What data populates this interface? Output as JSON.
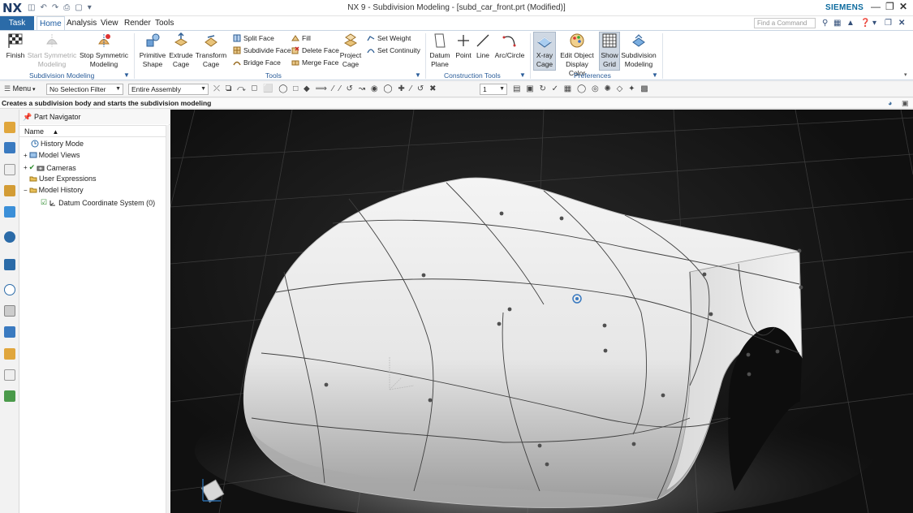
{
  "app": {
    "logo": "NX",
    "window_title": "NX 9 - Subdivision Modeling - [subd_car_front.prt (Modified)]",
    "brand": "SIEMENS"
  },
  "tabs": [
    {
      "label": "Task"
    },
    {
      "label": "Home"
    },
    {
      "label": "Analysis"
    },
    {
      "label": "View"
    },
    {
      "label": "Render"
    },
    {
      "label": "Tools"
    }
  ],
  "find_command": {
    "placeholder": "Find a Command"
  },
  "ribbon": {
    "subdivision_modeling": {
      "label": "Subdivision Modeling",
      "finish": "Finish",
      "start_symmetric_line1": "Start Symmetric",
      "start_symmetric_line2": "Modeling",
      "stop_symmetric_line1": "Stop Symmetric",
      "stop_symmetric_line2": "Modeling"
    },
    "tools": {
      "label": "Tools",
      "primitive_line1": "Primitive",
      "primitive_line2": "Shape",
      "extrude_line1": "Extrude",
      "extrude_line2": "Cage",
      "transform_line1": "Transform",
      "transform_line2": "Cage",
      "split_face": "Split Face",
      "subdivide_face": "Subdivide Face",
      "bridge_face": "Bridge Face",
      "fill": "Fill",
      "delete_face": "Delete Face",
      "merge_face": "Merge Face",
      "project_line1": "Project",
      "project_line2": "Cage",
      "set_weight": "Set Weight",
      "set_continuity": "Set Continuity"
    },
    "construction_tools": {
      "label": "Construction Tools",
      "datum_line1": "Datum",
      "datum_line2": "Plane",
      "point": "Point",
      "line": "Line",
      "arc": "Arc/Circle"
    },
    "preferences": {
      "label": "Preferences",
      "xray_line1": "X-ray",
      "xray_line2": "Cage",
      "edit_line1": "Edit Object",
      "edit_line2": "Display Color",
      "grid_line1": "Show",
      "grid_line2": "Grid",
      "subdiv_line1": "Subdivision",
      "subdiv_line2": "Modeling"
    }
  },
  "toolbar": {
    "menu": "Menu",
    "selection_filter": "No Selection Filter",
    "assembly_scope": "Entire Assembly",
    "layer": "1"
  },
  "status": {
    "text": "Creates a subdivision body and starts the subdivision modeling"
  },
  "navigator": {
    "title": "Part Navigator",
    "column": "Name",
    "nodes": [
      {
        "label": "History Mode"
      },
      {
        "label": "Model Views"
      },
      {
        "label": "Cameras"
      },
      {
        "label": "User Expressions"
      },
      {
        "label": "Model History"
      },
      {
        "label": "Datum Coordinate System (0)"
      }
    ]
  }
}
